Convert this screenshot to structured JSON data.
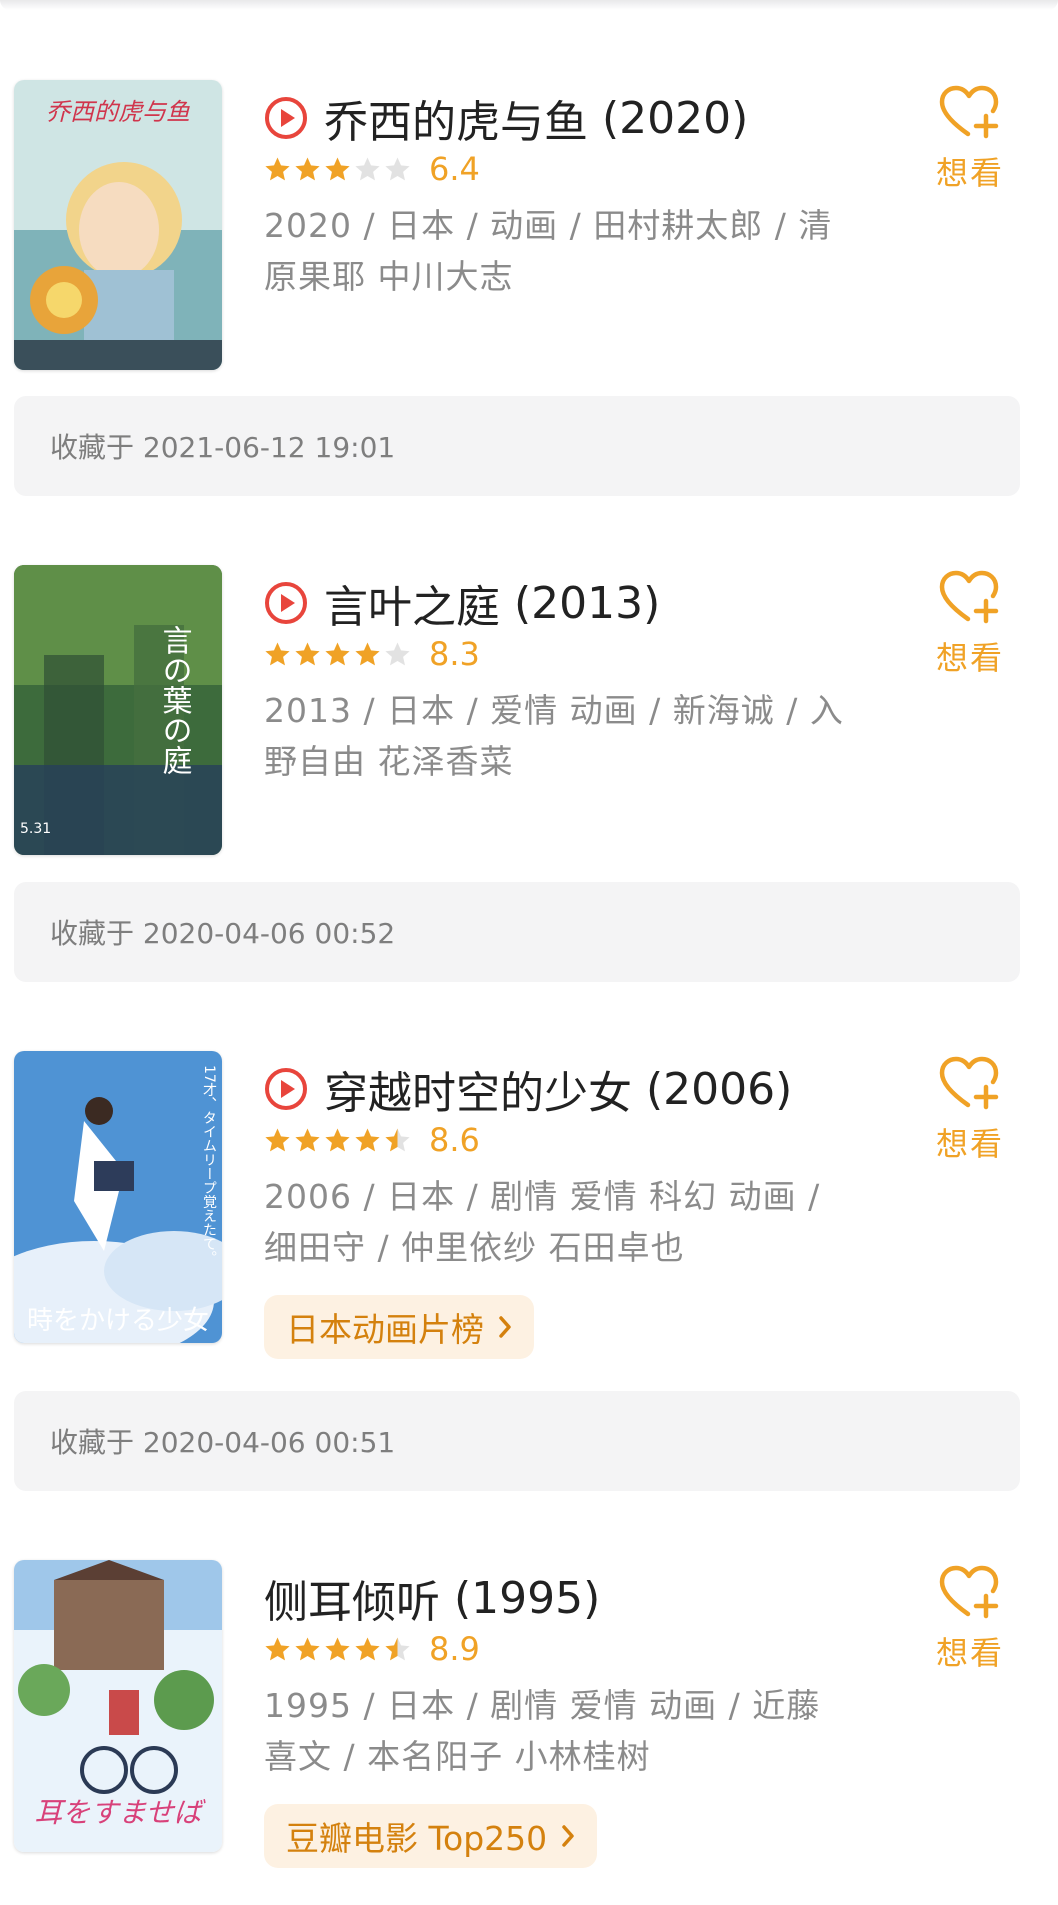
{
  "want_label": "想看",
  "items": [
    {
      "title": "乔西的虎与鱼",
      "year": "(2020)",
      "rating": 6.4,
      "stars": 3,
      "score": "6.4",
      "meta": "2020 / 日本 / 动画 / 田村耕太郎 / 清原果耶 中川大志",
      "saved": "收藏于 2021-06-12 19:01"
    },
    {
      "title": "言叶之庭",
      "year": "(2013)",
      "rating": 8.3,
      "stars": 4,
      "score": "8.3",
      "meta": "2013 / 日本 / 爱情 动画 / 新海诚 / 入野自由 花泽香菜",
      "saved": "收藏于 2020-04-06 00:52"
    },
    {
      "title": "穿越时空的少女",
      "year": "(2006)",
      "rating": 8.6,
      "stars": 4.5,
      "score": "8.6",
      "meta": "2006 / 日本 / 剧情 爱情 科幻 动画 / 细田守 / 仲里依纱 石田卓也",
      "tag": "日本动画片榜",
      "saved": "收藏于 2020-04-06 00:51"
    },
    {
      "title": "侧耳倾听",
      "year": "(1995)",
      "rating": 8.9,
      "stars": 4.5,
      "score": "8.9",
      "meta": "1995 / 日本 / 剧情 爱情 动画 / 近藤喜文 / 本名阳子 小林桂树",
      "tag": "豆瓣电影 Top250"
    }
  ],
  "poster_text": {
    "p0": "乔西的虎与鱼",
    "p1": "言の葉の庭",
    "p1_date": "5.31",
    "p2": "時をかける少女",
    "p2_side": "17才、タイムリープ覚えたて。",
    "p3": "耳をすませば"
  },
  "colors": {
    "accent": "#f0a226",
    "play_red": "#e8453c",
    "star_empty": "#e2e2e2",
    "tag_bg": "#fdf1e2",
    "tag_text": "#d4810e"
  }
}
